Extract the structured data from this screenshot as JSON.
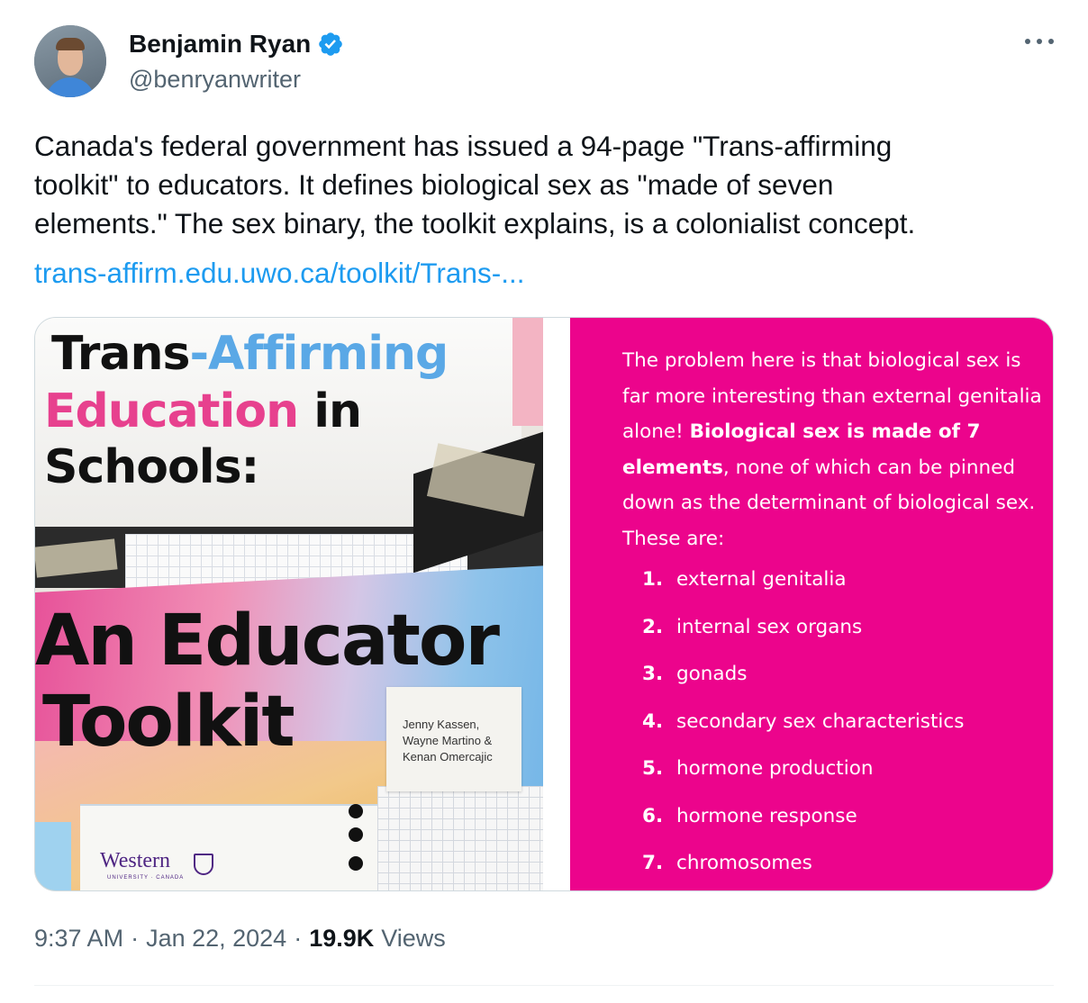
{
  "author": {
    "name": "Benjamin Ryan",
    "handle": "@benryanwriter",
    "verified_color": "#1d9bf0"
  },
  "tweet": {
    "lines": [
      "Canada's federal government has issued a 94-page \"Trans-affirming",
      "toolkit\" to educators. It defines biological sex as \"made of seven",
      "elements.\" The sex binary, the toolkit explains, is a colonialist concept."
    ],
    "link": "trans-affirm.edu.uwo.ca/toolkit/Trans-..."
  },
  "cover": {
    "title_trans": "Trans",
    "title_affirming": "-Affirming",
    "title_education": "Education",
    "title_in": " in",
    "title_schools": "Schools:",
    "subtitle_line1": "An Educator",
    "subtitle_line2": "Toolkit",
    "authors": [
      "Jenny Kassen,",
      "Wayne Martino &",
      "Kenan Omercajic"
    ],
    "logo_text": "Western",
    "logo_subtext": "UNIVERSITY · CANADA"
  },
  "panel": {
    "bg_color": "#ec048c",
    "intro_plain_1": "The problem here is that biological sex is far more interesting than external genitalia alone! ",
    "intro_bold": "Biological sex is made of 7 elements",
    "intro_plain_2": ", none of which can be pinned down as the determinant of biological sex. These are:",
    "items": [
      {
        "num": "1.",
        "text": "external genitalia"
      },
      {
        "num": "2.",
        "text": "internal sex organs"
      },
      {
        "num": "3.",
        "text": "gonads"
      },
      {
        "num": "4.",
        "text": "secondary sex characteristics"
      },
      {
        "num": "5.",
        "text": "hormone production"
      },
      {
        "num": "6.",
        "text": "hormone response"
      },
      {
        "num": "7.",
        "text": "chromosomes"
      }
    ]
  },
  "meta": {
    "time": "9:37 AM",
    "separator": "·",
    "date": "Jan 22, 2024",
    "views_count": "19.9K",
    "views_label": "Views"
  }
}
